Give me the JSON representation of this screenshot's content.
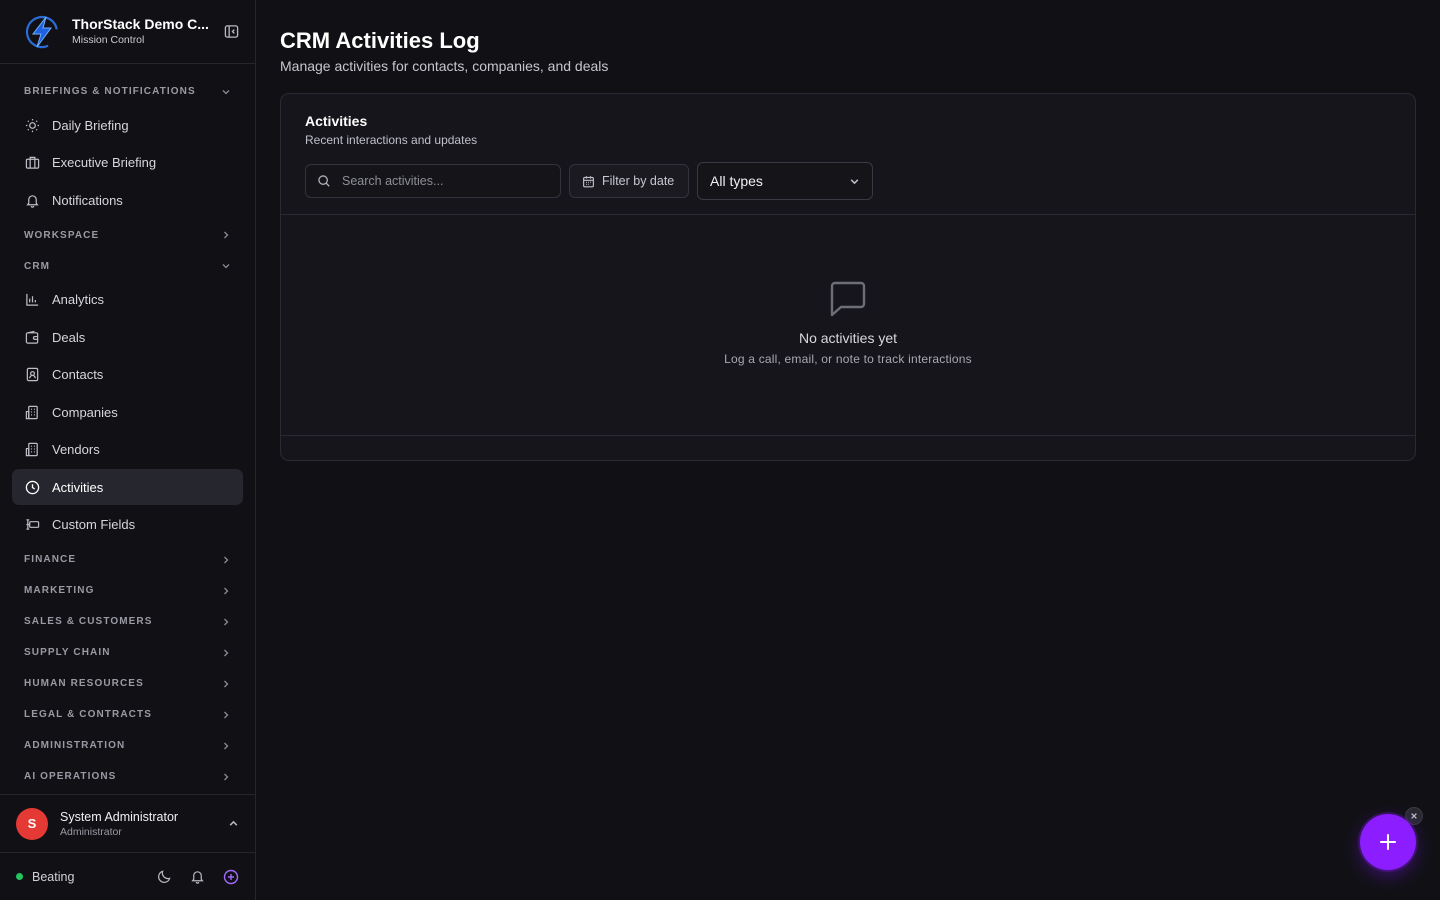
{
  "org": {
    "name": "ThorStack Demo C...",
    "subtitle": "Mission Control"
  },
  "sidebar": {
    "sections": {
      "briefings": "BRIEFINGS & NOTIFICATIONS",
      "workspace": "WORKSPACE",
      "crm": "CRM",
      "finance": "FINANCE",
      "marketing": "MARKETING",
      "sales": "SALES & CUSTOMERS",
      "supply": "SUPPLY CHAIN",
      "hr": "HUMAN RESOURCES",
      "legal": "LEGAL & CONTRACTS",
      "admin": "ADMINISTRATION",
      "ai": "AI OPERATIONS"
    },
    "briefing_items": [
      {
        "label": "Daily Briefing",
        "icon": "sun-icon"
      },
      {
        "label": "Executive Briefing",
        "icon": "briefcase-icon"
      },
      {
        "label": "Notifications",
        "icon": "bell-icon"
      }
    ],
    "crm_items": [
      {
        "label": "Analytics",
        "icon": "bar-chart-icon"
      },
      {
        "label": "Deals",
        "icon": "wallet-icon"
      },
      {
        "label": "Contacts",
        "icon": "contact-card-icon"
      },
      {
        "label": "Companies",
        "icon": "building-icon"
      },
      {
        "label": "Vendors",
        "icon": "building-icon"
      },
      {
        "label": "Activities",
        "icon": "clock-icon",
        "active": true
      },
      {
        "label": "Custom Fields",
        "icon": "form-field-icon"
      }
    ]
  },
  "user": {
    "initial": "S",
    "name": "System Administrator",
    "role": "Administrator"
  },
  "footer": {
    "status": "Beating",
    "status_color": "#22c55e"
  },
  "page": {
    "title": "CRM Activities Log",
    "subtitle": "Manage activities for contacts, companies, and deals"
  },
  "card": {
    "title": "Activities",
    "subtitle": "Recent interactions and updates",
    "search_placeholder": "Search activities...",
    "date_filter_label": "Filter by date",
    "type_select_value": "All types",
    "empty_title": "No activities yet",
    "empty_subtitle": "Log a call, email, or note to track interactions"
  },
  "colors": {
    "accent": "#8b1dff",
    "avatar": "#e53935",
    "active_bg": "#26262e"
  }
}
